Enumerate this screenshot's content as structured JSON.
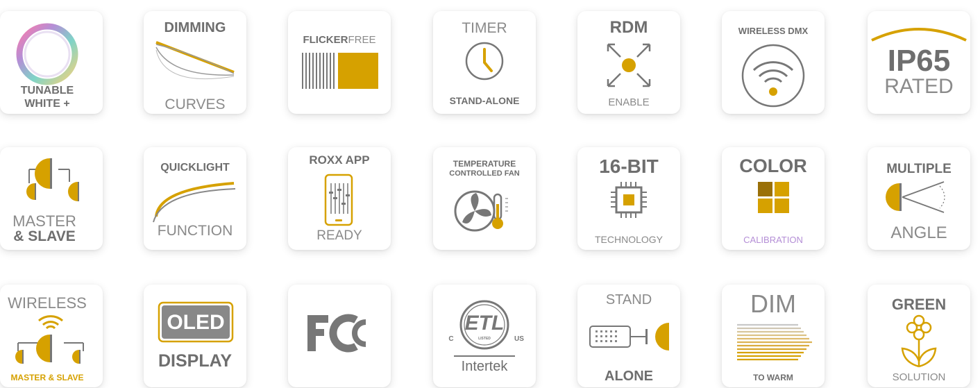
{
  "colors": {
    "gold": "#d6a100",
    "gray": "#6e6e6e",
    "light_gray": "#8a8a8a",
    "tile_bg": "#ffffff",
    "purple": "#b48ed6"
  },
  "tiles": {
    "tunable": {
      "line1": "TUNABLE",
      "line2": "WHITE +",
      "icon": "color-ring-icon"
    },
    "dimming": {
      "top": "DIMMING",
      "bottom": "CURVES",
      "icon": "dimming-curves-icon"
    },
    "flicker": {
      "bold": "FLICKER",
      "light": "FREE",
      "icon": "flicker-bars-icon"
    },
    "timer": {
      "top": "TIMER",
      "bottom": "STAND-ALONE",
      "icon": "clock-icon"
    },
    "rdm": {
      "top": "RDM",
      "bottom": "ENABLE",
      "icon": "expand-arrows-icon"
    },
    "wireless_dmx": {
      "top": "WIRELESS DMX",
      "icon": "wifi-icon"
    },
    "ip65": {
      "top": "IP65",
      "bottom": "RATED",
      "icon": "arc-icon"
    },
    "master_slave": {
      "line1": "MASTER",
      "line2": "& SLAVE",
      "icon": "fixtures-icon"
    },
    "quicklight": {
      "top": "QUICKLIGHT",
      "bottom": "FUNCTION",
      "icon": "quicklight-curve-icon"
    },
    "roxx_app": {
      "top": "ROXX APP",
      "bottom": "READY",
      "icon": "phone-faders-icon"
    },
    "temperature": {
      "line1": "TEMPERATURE",
      "line2": "CONTROLLED FAN",
      "icon": "fan-thermometer-icon"
    },
    "sixteen_bit": {
      "top": "16-BIT",
      "bottom": "TECHNOLOGY",
      "icon": "chip-icon"
    },
    "color": {
      "top": "COLOR",
      "bottom": "CALIBRATION",
      "icon": "color-squares-icon"
    },
    "multiple": {
      "top": "MULTIPLE",
      "bottom": "ANGLE",
      "icon": "beam-angle-icon"
    },
    "wireless_ms": {
      "top": "WIRELESS",
      "bottom": "MASTER & SLAVE",
      "icon": "wireless-fixtures-icon"
    },
    "oled": {
      "badge": "OLED",
      "bottom": "DISPLAY",
      "icon": "oled-screen-icon"
    },
    "fcc": {
      "logo_text": "FC",
      "icon": "fcc-logo-icon"
    },
    "etl": {
      "logo_text": "ETL",
      "left": "C",
      "right": "US",
      "small": "LISTED",
      "bottom": "Intertek",
      "icon": "etl-logo-icon"
    },
    "stand_alone": {
      "top": "STAND",
      "bottom": "ALONE",
      "icon": "controller-fixture-icon"
    },
    "dim_to_warm": {
      "top": "DIM",
      "bottom": "TO WARM",
      "icon": "warm-lines-icon"
    },
    "green": {
      "top": "GREEN",
      "bottom": "SOLUTION",
      "icon": "plant-icon"
    }
  }
}
